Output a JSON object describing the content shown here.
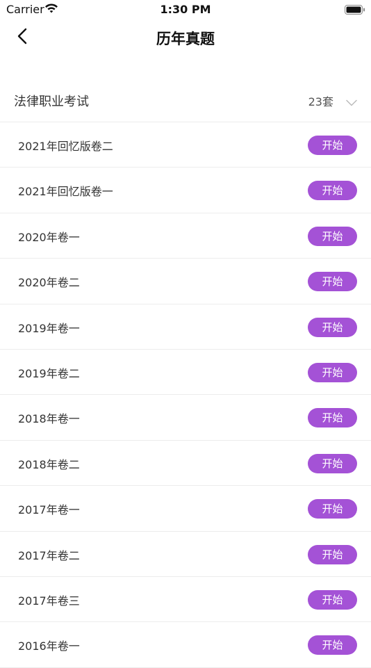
{
  "status_bar": {
    "carrier": "Carrier",
    "time": "1:30 PM"
  },
  "nav": {
    "title": "历年真题"
  },
  "category": {
    "name": "法律职业考试",
    "count": "23套"
  },
  "items": [
    {
      "title": "2021年回忆版卷二",
      "action": "开始"
    },
    {
      "title": "2021年回忆版卷一",
      "action": "开始"
    },
    {
      "title": "2020年卷一",
      "action": "开始"
    },
    {
      "title": "2020年卷二",
      "action": "开始"
    },
    {
      "title": "2019年卷一",
      "action": "开始"
    },
    {
      "title": "2019年卷二",
      "action": "开始"
    },
    {
      "title": "2018年卷一",
      "action": "开始"
    },
    {
      "title": "2018年卷二",
      "action": "开始"
    },
    {
      "title": "2017年卷一",
      "action": "开始"
    },
    {
      "title": "2017年卷二",
      "action": "开始"
    },
    {
      "title": "2017年卷三",
      "action": "开始"
    },
    {
      "title": "2016年卷一",
      "action": "开始"
    }
  ],
  "colors": {
    "accent": "#a452d6"
  },
  "icons": {
    "back": "chevron-left-icon",
    "dropdown": "chevron-down-icon",
    "wifi": "wifi-icon",
    "battery": "battery-icon"
  }
}
